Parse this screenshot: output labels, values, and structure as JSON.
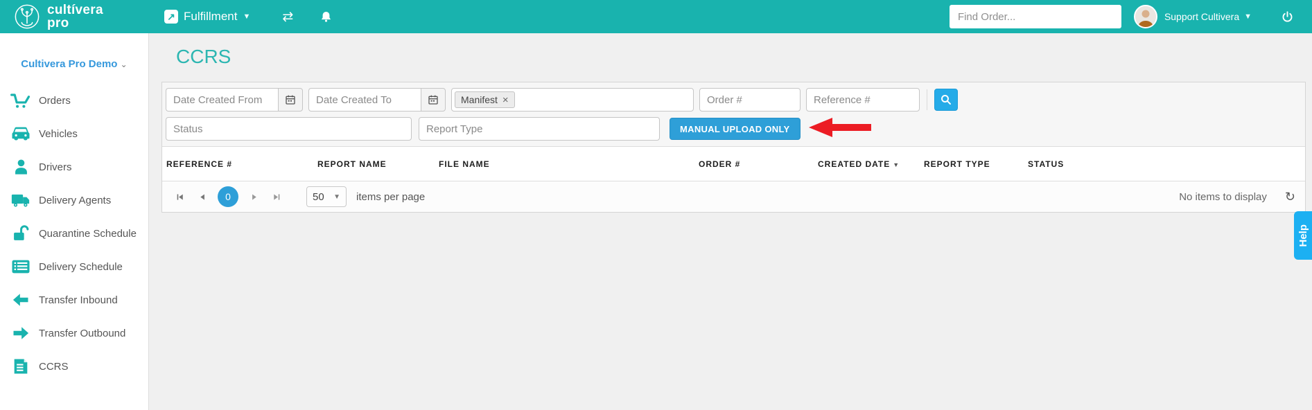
{
  "header": {
    "logo_line1": "cultívera",
    "logo_line2": "pro",
    "app_menu": "Fulfillment",
    "find_order_placeholder": "Find Order...",
    "user_name": "Support Cultivera"
  },
  "sidebar": {
    "company": "Cultivera Pro Demo",
    "items": [
      {
        "label": "Orders",
        "icon": "cart-icon"
      },
      {
        "label": "Vehicles",
        "icon": "car-icon"
      },
      {
        "label": "Drivers",
        "icon": "person-icon"
      },
      {
        "label": "Delivery Agents",
        "icon": "truck-icon"
      },
      {
        "label": "Quarantine Schedule",
        "icon": "open-lock-icon"
      },
      {
        "label": "Delivery Schedule",
        "icon": "schedule-list-icon"
      },
      {
        "label": "Transfer Inbound",
        "icon": "arrow-left-icon"
      },
      {
        "label": "Transfer Outbound",
        "icon": "arrow-right-icon"
      },
      {
        "label": "CCRS",
        "icon": "document-icon"
      }
    ]
  },
  "main": {
    "title": "CCRS",
    "filters": {
      "date_from_placeholder": "Date Created From",
      "date_to_placeholder": "Date Created To",
      "manifest_tag": "Manifest",
      "remove_tag_glyph": "×",
      "order_placeholder": "Order #",
      "reference_placeholder": "Reference #",
      "status_placeholder": "Status",
      "report_type_placeholder": "Report Type",
      "manual_upload_button": "MANUAL UPLOAD ONLY"
    },
    "table": {
      "columns": [
        "REFERENCE #",
        "REPORT NAME",
        "FILE NAME",
        "ORDER #",
        "CREATED DATE",
        "REPORT TYPE",
        "STATUS"
      ],
      "sorted_column": "CREATED DATE",
      "sort_direction": "desc",
      "rows": []
    },
    "pager": {
      "current_page": "0",
      "page_size": "50",
      "items_per_page_label": "items per page",
      "no_items_text": "No items to display"
    }
  },
  "help_tab": "Help",
  "colors": {
    "brand_teal": "#19b3ae",
    "accent_blue": "#2e9fd8",
    "search_blue": "#25abe8",
    "help_blue": "#1cb0f2",
    "link_blue": "#3598dc",
    "annotation_red": "#ec1c24"
  }
}
